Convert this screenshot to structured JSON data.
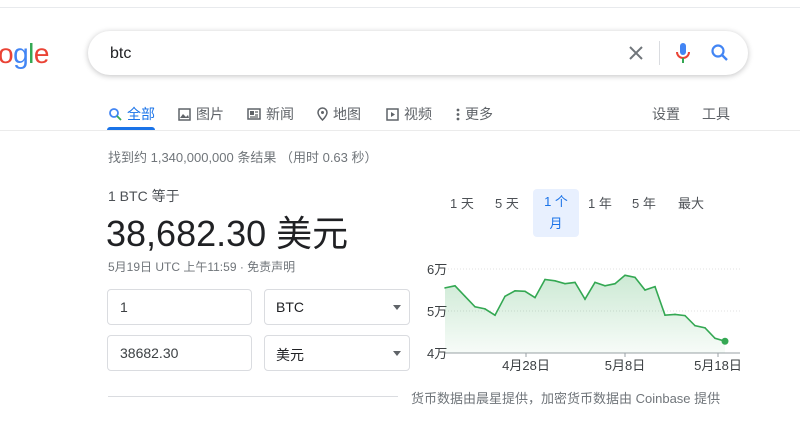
{
  "logo": {
    "t1": "o",
    "t2": "g",
    "t3": "l",
    "t4": "e"
  },
  "search": {
    "query": "btc"
  },
  "tabs": [
    {
      "label": "全部",
      "icon": "search-icon"
    },
    {
      "label": "图片",
      "icon": "image-icon"
    },
    {
      "label": "新闻",
      "icon": "news-icon"
    },
    {
      "label": "地图",
      "icon": "map-pin-icon"
    },
    {
      "label": "视频",
      "icon": "video-icon"
    },
    {
      "label": "更多",
      "icon": "more-icon"
    }
  ],
  "tools": {
    "settings": "设置",
    "tools": "工具"
  },
  "result_stats": "找到约 1,340,000,000 条结果 （用时 0.63 秒）",
  "converter": {
    "label": "1 BTC 等于",
    "value": "38,682.30 美元",
    "meta": "5月19日 UTC 上午11:59 · 免责声明",
    "from_amount": "1",
    "from_currency": "BTC",
    "to_amount": "38682.30",
    "to_currency": "美元"
  },
  "ranges": [
    "1 天",
    "5 天",
    "1 个\n月",
    "1 年",
    "5 年",
    "最大"
  ],
  "source_text": "货币数据由晨星提供，加密货币数据由 Coinbase 提供",
  "colors": {
    "accent": "#1a73e8",
    "line": "#34a853"
  },
  "chart_data": {
    "type": "area",
    "title": "",
    "xlabel": "",
    "ylabel": "",
    "y_ticks": [
      "6万",
      "5万",
      "4万"
    ],
    "x_ticks": [
      "4月28日",
      "5月8日",
      "5月18日"
    ],
    "ylim": [
      40000,
      60000
    ],
    "series": [
      {
        "values": [
          55500,
          56000,
          53500,
          51000,
          50500,
          49000,
          53500,
          54800,
          54700,
          53200,
          57500,
          57200,
          56500,
          56800,
          52800,
          56800,
          56000,
          56500,
          58500,
          58000,
          55000,
          55800,
          49000,
          49200,
          48900,
          46500,
          46000,
          43500,
          42800
        ]
      }
    ]
  }
}
